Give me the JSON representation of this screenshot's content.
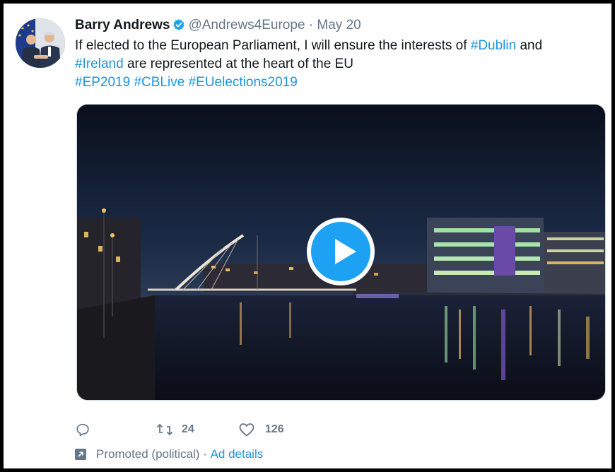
{
  "tweet": {
    "author_name": "Barry Andrews",
    "handle": "@Andrews4Europe",
    "separator": "·",
    "date": "May 20",
    "text_line1_a": "If elected to the European Parliament, I will ensure the interests of ",
    "text_line1_tag": "#Dublin",
    "text_line1_b": " and",
    "text_line2_tag": "#Ireland",
    "text_line2_b": " are represented at the heart of the EU",
    "hashtags": [
      "#EP2019",
      "#CBLive",
      "#EUelections2019"
    ]
  },
  "actions": {
    "reply_count": "",
    "retweet_count": "24",
    "like_count": "126"
  },
  "promo": {
    "label": "Promoted (political)",
    "separator": " · ",
    "ad_details": "Ad details"
  },
  "colors": {
    "link": "#1b95e0",
    "verified": "#1da1f2",
    "muted": "#657786",
    "play_button": "#1da1f2"
  },
  "icons": [
    "verified-badge-icon",
    "play-icon",
    "reply-icon",
    "retweet-icon",
    "like-icon",
    "promoted-icon"
  ]
}
